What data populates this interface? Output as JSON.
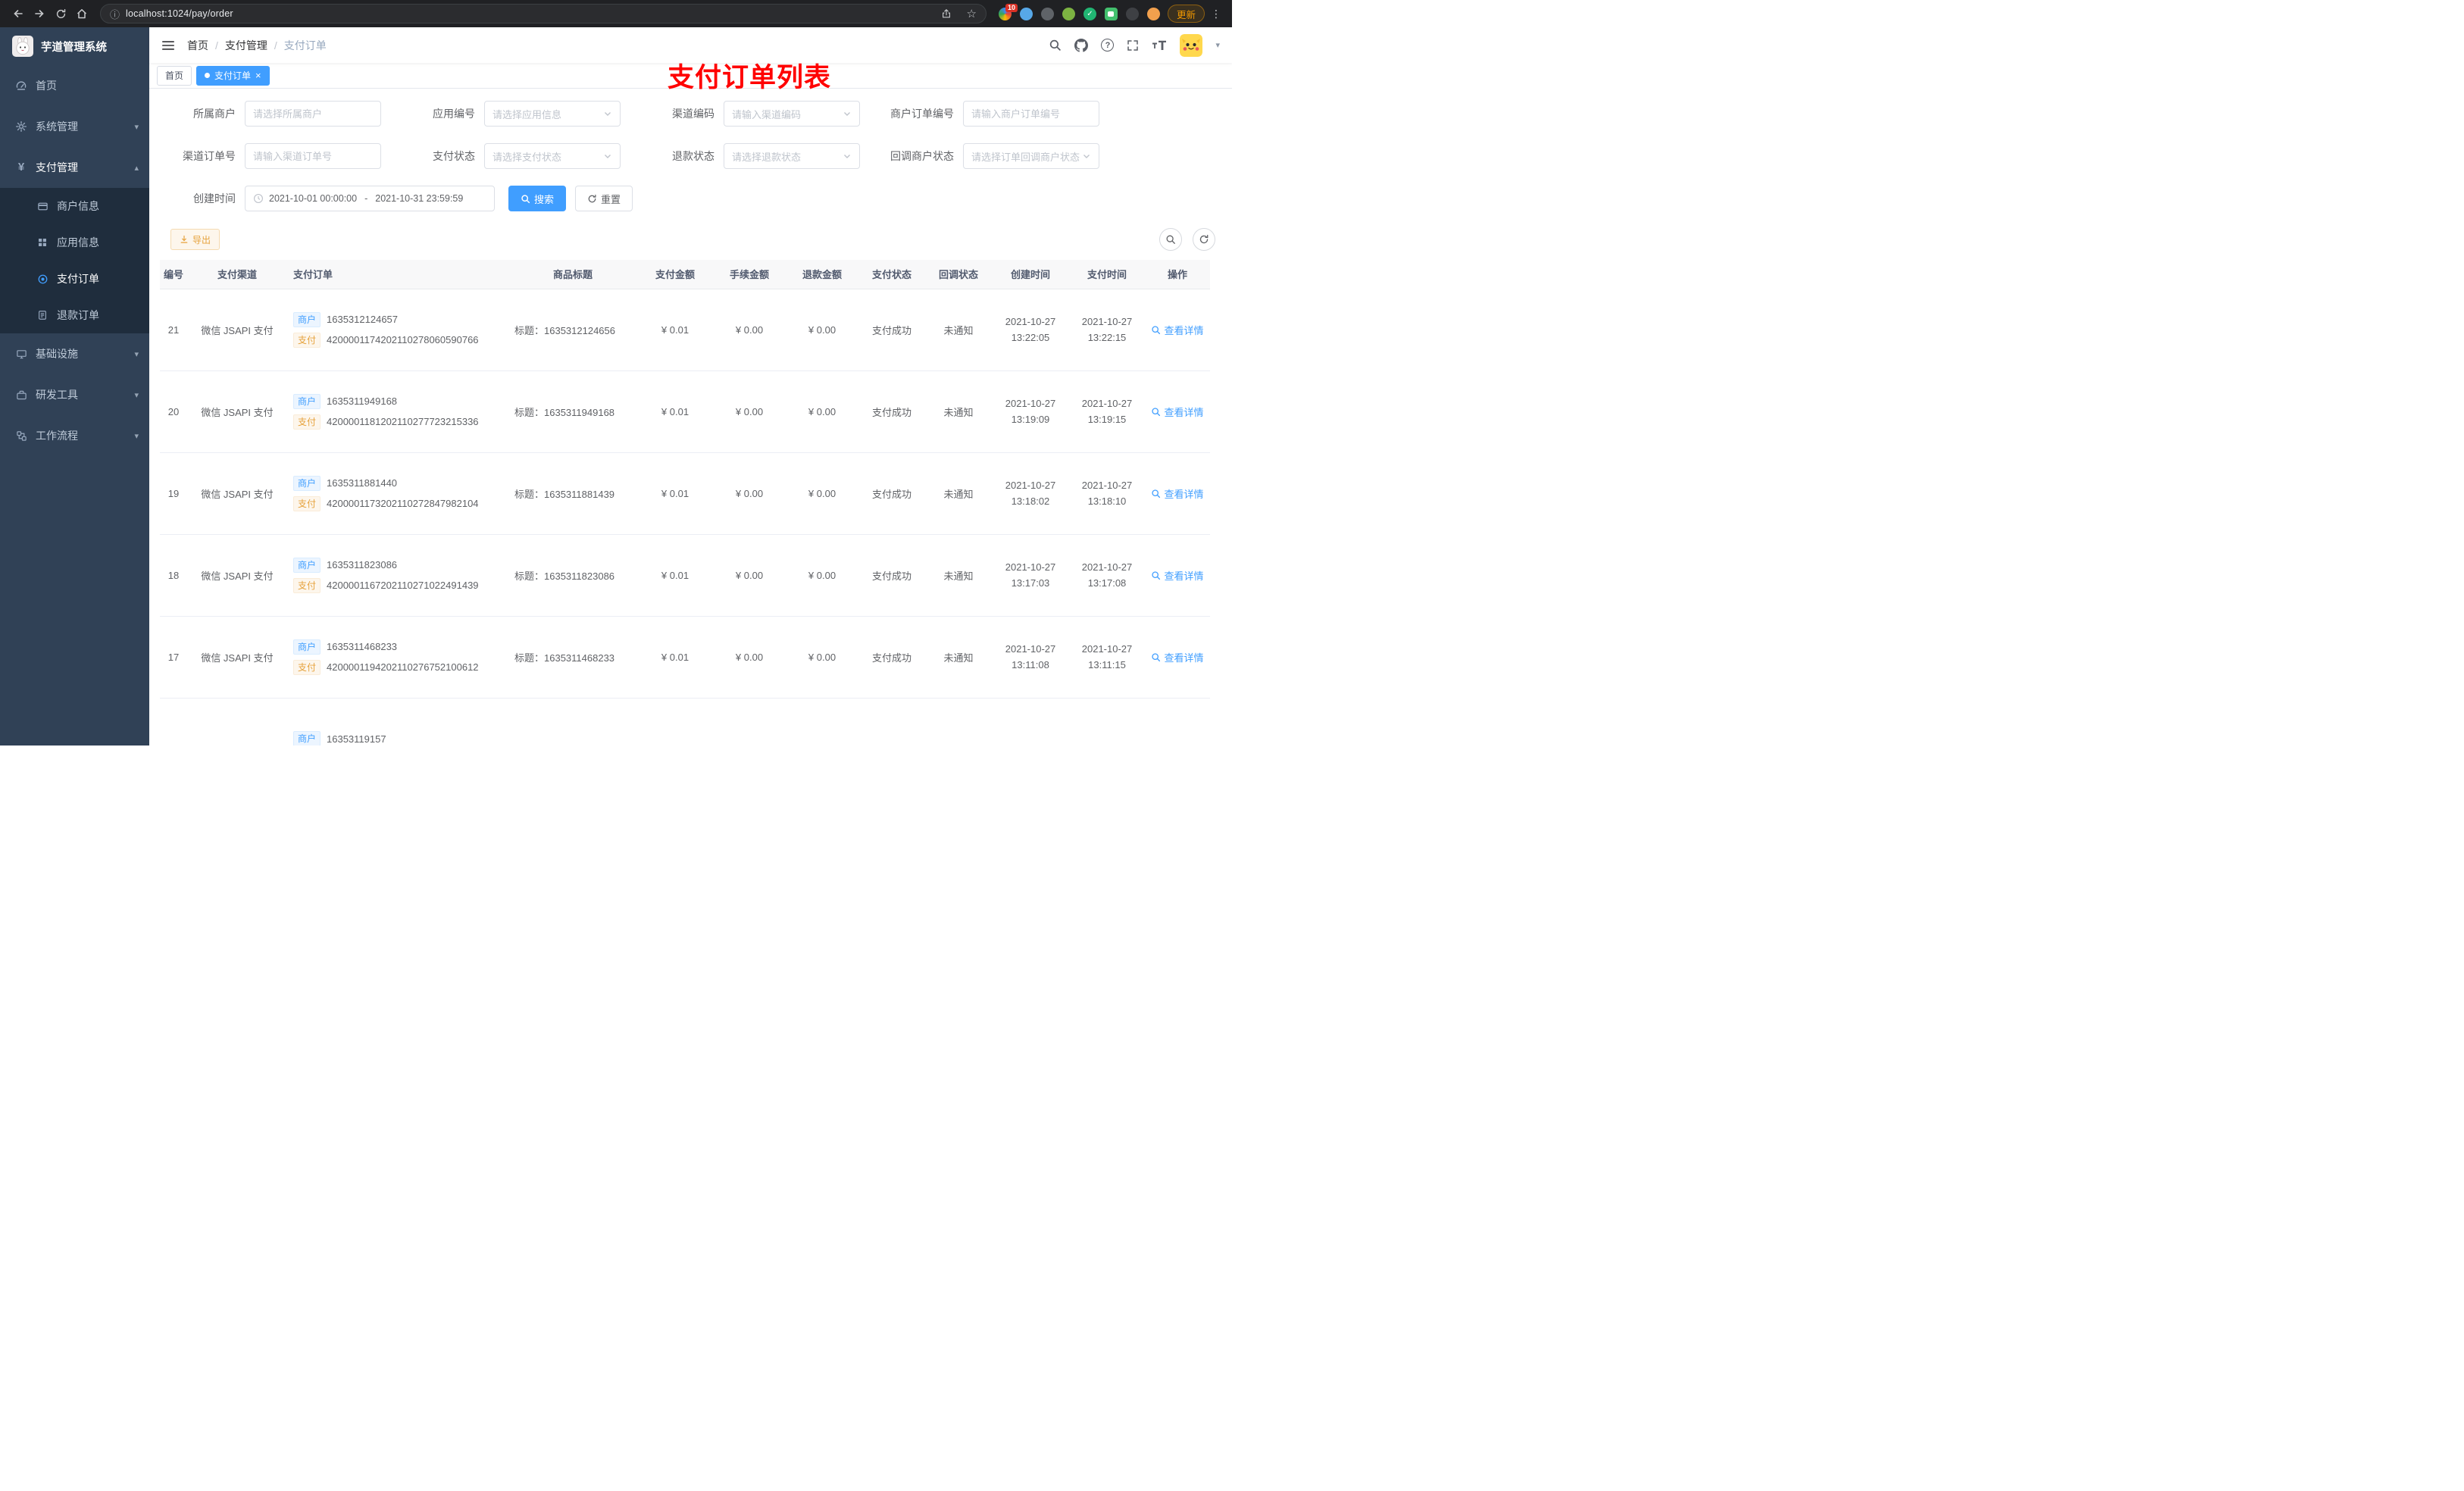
{
  "colors": {
    "primary": "#409eff",
    "warning": "#e6a23c",
    "sidebar_bg": "#304156",
    "annotation_red": "#ff0000"
  },
  "icons": {
    "close": "×",
    "star": "☆",
    "kebab": "⋮",
    "caret_down": "▾",
    "chevron_down": "▾",
    "chevron_up": "▴",
    "info": "ⓘ",
    "question": "?",
    "separator": "/"
  },
  "browser": {
    "url": "localhost:1024/pay/order",
    "update_label": "更新",
    "ext_badge": "10"
  },
  "annotation": "支付订单列表",
  "sidebar": {
    "title": "芋道管理系统",
    "menu": [
      {
        "label": "首页"
      },
      {
        "label": "系统管理"
      },
      {
        "label": "支付管理"
      },
      {
        "label": "基础设施"
      },
      {
        "label": "研发工具"
      },
      {
        "label": "工作流程"
      }
    ],
    "submenu": [
      {
        "label": "商户信息"
      },
      {
        "label": "应用信息"
      },
      {
        "label": "支付订单"
      },
      {
        "label": "退款订单"
      }
    ]
  },
  "breadcrumb": [
    "首页",
    "支付管理",
    "支付订单"
  ],
  "tabs": [
    {
      "label": "首页"
    },
    {
      "label": "支付订单"
    }
  ],
  "filters": {
    "merchant": {
      "label": "所属商户",
      "placeholder": "请选择所属商户"
    },
    "app": {
      "label": "应用编号",
      "placeholder": "请选择应用信息"
    },
    "channel_code": {
      "label": "渠道编码",
      "placeholder": "请输入渠道编码"
    },
    "merchant_order_no": {
      "label": "商户订单编号",
      "placeholder": "请输入商户订单编号"
    },
    "channel_order_no": {
      "label": "渠道订单号",
      "placeholder": "请输入渠道订单号"
    },
    "pay_status": {
      "label": "支付状态",
      "placeholder": "请选择支付状态"
    },
    "refund_status": {
      "label": "退款状态",
      "placeholder": "请选择退款状态"
    },
    "notify_status": {
      "label": "回调商户状态",
      "placeholder": "请选择订单回调商户状态"
    },
    "create_time": {
      "label": "创建时间",
      "start": "2021-10-01 00:00:00",
      "sep": "-",
      "end": "2021-10-31 23:59:59"
    },
    "search_label": "搜索",
    "reset_label": "重置"
  },
  "toolbar": {
    "export_label": "导出"
  },
  "table": {
    "columns": [
      "编号",
      "支付渠道",
      "支付订单",
      "商品标题",
      "支付金额",
      "手续金额",
      "退款金额",
      "支付状态",
      "回调状态",
      "创建时间",
      "支付时间",
      "操作"
    ],
    "rows": [
      {
        "id": "21",
        "channel": "微信 JSAPI 支付",
        "merchant_tag": "商户",
        "merchant_no": "1635312124657",
        "pay_tag": "支付",
        "pay_no": "4200001174202110278060590766",
        "title": "标题：1635312124656",
        "amount": "¥ 0.01",
        "fee": "¥ 0.00",
        "refund": "¥ 0.00",
        "status": "支付成功",
        "notify": "未通知",
        "create_date": "2021-10-27",
        "create_time": "13:22:05",
        "pay_date": "2021-10-27",
        "pay_time": "13:22:15",
        "action": "查看详情"
      },
      {
        "id": "20",
        "channel": "微信 JSAPI 支付",
        "merchant_tag": "商户",
        "merchant_no": "1635311949168",
        "pay_tag": "支付",
        "pay_no": "4200001181202110277723215336",
        "title": "标题：1635311949168",
        "amount": "¥ 0.01",
        "fee": "¥ 0.00",
        "refund": "¥ 0.00",
        "status": "支付成功",
        "notify": "未通知",
        "create_date": "2021-10-27",
        "create_time": "13:19:09",
        "pay_date": "2021-10-27",
        "pay_time": "13:19:15",
        "action": "查看详情"
      },
      {
        "id": "19",
        "channel": "微信 JSAPI 支付",
        "merchant_tag": "商户",
        "merchant_no": "1635311881440",
        "pay_tag": "支付",
        "pay_no": "4200001173202110272847982104",
        "title": "标题：1635311881439",
        "amount": "¥ 0.01",
        "fee": "¥ 0.00",
        "refund": "¥ 0.00",
        "status": "支付成功",
        "notify": "未通知",
        "create_date": "2021-10-27",
        "create_time": "13:18:02",
        "pay_date": "2021-10-27",
        "pay_time": "13:18:10",
        "action": "查看详情"
      },
      {
        "id": "18",
        "channel": "微信 JSAPI 支付",
        "merchant_tag": "商户",
        "merchant_no": "1635311823086",
        "pay_tag": "支付",
        "pay_no": "4200001167202110271022491439",
        "title": "标题：1635311823086",
        "amount": "¥ 0.01",
        "fee": "¥ 0.00",
        "refund": "¥ 0.00",
        "status": "支付成功",
        "notify": "未通知",
        "create_date": "2021-10-27",
        "create_time": "13:17:03",
        "pay_date": "2021-10-27",
        "pay_time": "13:17:08",
        "action": "查看详情"
      },
      {
        "id": "17",
        "channel": "微信 JSAPI 支付",
        "merchant_tag": "商户",
        "merchant_no": "1635311468233",
        "pay_tag": "支付",
        "pay_no": "4200001194202110276752100612",
        "title": "标题：1635311468233",
        "amount": "¥ 0.01",
        "fee": "¥ 0.00",
        "refund": "¥ 0.00",
        "status": "支付成功",
        "notify": "未通知",
        "create_date": "2021-10-27",
        "create_time": "13:11:08",
        "pay_date": "2021-10-27",
        "pay_time": "13:11:15",
        "action": "查看详情"
      }
    ],
    "partial_row": {
      "merchant_tag": "商户",
      "merchant_no": "16353119157"
    }
  }
}
